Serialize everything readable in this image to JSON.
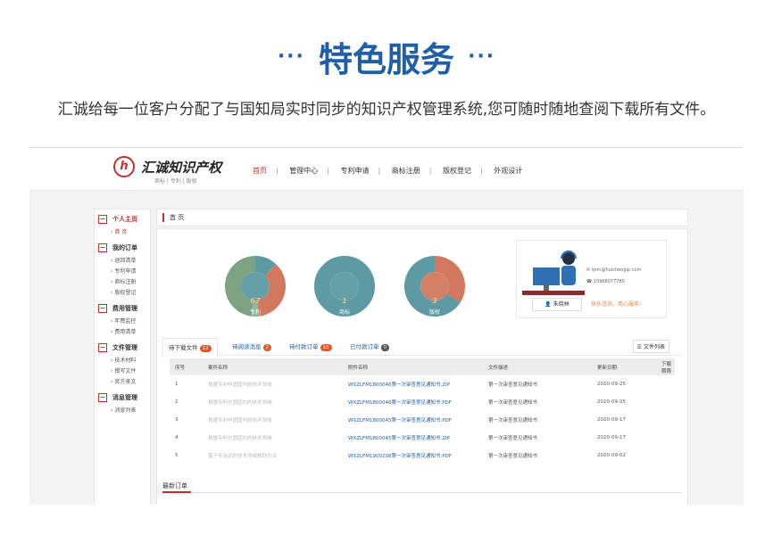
{
  "heading": {
    "dots_left": "···",
    "title": "特色服务",
    "dots_right": "···"
  },
  "subtitle": "汇诚给每一位客户分配了与国知局实时同步的知识产权管理系统,您可随时随地查阅下载所有文件。",
  "colors": {
    "accent_blue": "#1e5fa8",
    "brand_red": "#c0312b",
    "badge_orange": "#e05a2b"
  },
  "app": {
    "logo": {
      "name": "汇诚知识产权",
      "tagline": "商标 | 专利 | 版权"
    },
    "nav": [
      "首页",
      "管理中心",
      "专利申请",
      "商标注册",
      "版权登记",
      "外观设计"
    ],
    "breadcrumb": "首 页",
    "sidebar": [
      {
        "title": "个人主页",
        "items": [
          "首 页"
        ]
      },
      {
        "title": "我的订单",
        "items": [
          "退回清单",
          "专利申请",
          "商标注册",
          "版权登记"
        ]
      },
      {
        "title": "费用管理",
        "items": [
          "年费监控",
          "费用清单"
        ]
      },
      {
        "title": "文件管理",
        "items": [
          "技术材料",
          "撰写文件",
          "官方来文"
        ]
      },
      {
        "title": "消息管理",
        "items": [
          "消息列表"
        ]
      }
    ],
    "donuts": [
      {
        "value": "67",
        "label": "专利",
        "fractions": [
          0.12,
          0.36,
          0.04,
          0.48
        ]
      },
      {
        "value": "1",
        "label": "商标",
        "fractions": [
          1.0
        ]
      },
      {
        "value": "3",
        "label": "版权",
        "fractions": [
          0.34,
          0.66
        ]
      }
    ],
    "contact": {
      "email": "lynn@huichengip.com",
      "phone": "15968077780",
      "name_button": "朱晓林",
      "slogan": "快乐咨询，用心服务!"
    },
    "tabs": [
      {
        "label": "待下载文件",
        "badge": "12"
      },
      {
        "label": "待阅读消息",
        "badge": "2"
      },
      {
        "label": "待付款订单",
        "badge": "10"
      },
      {
        "label": "已付款订单",
        "badge": "0"
      }
    ],
    "list_button": "文件列表",
    "table": {
      "headers": [
        "序号",
        "案件名称",
        "附件名称",
        "文件描述",
        "更新日期",
        "下载期限"
      ],
      "rows": [
        [
          "1",
          "根据专利中国国内的技术领域",
          "WXZLFM1800046第一次审查意见通知书.ZIP",
          "第一次审查意见通知书",
          "2020-09-25",
          ""
        ],
        [
          "2",
          "根据专利中国国内的技术领域",
          "WXZLFM1800046第一次审查意见通知书.PDF",
          "第一次审查意见通知书",
          "2020-09-25",
          ""
        ],
        [
          "3",
          "根据专利中国国内的技术领域",
          "WXZLFM1800045第一次审查意见通知书.PDF",
          "第一次审查意见通知书",
          "2020-09-17",
          ""
        ],
        [
          "4",
          "根据专利中国国内的技术领域",
          "WXZLFM1800045第一次审查意见通知书.ZIP",
          "第一次审查意见通知书",
          "2020-09-17",
          ""
        ],
        [
          "5",
          "基于多站式的技术领域规划方法",
          "WXZLFM1900236第一次审查意见通知书.PDF",
          "第一次审查意见通知书",
          "2020-09-02",
          ""
        ]
      ]
    },
    "latest_orders": "最新订单"
  }
}
